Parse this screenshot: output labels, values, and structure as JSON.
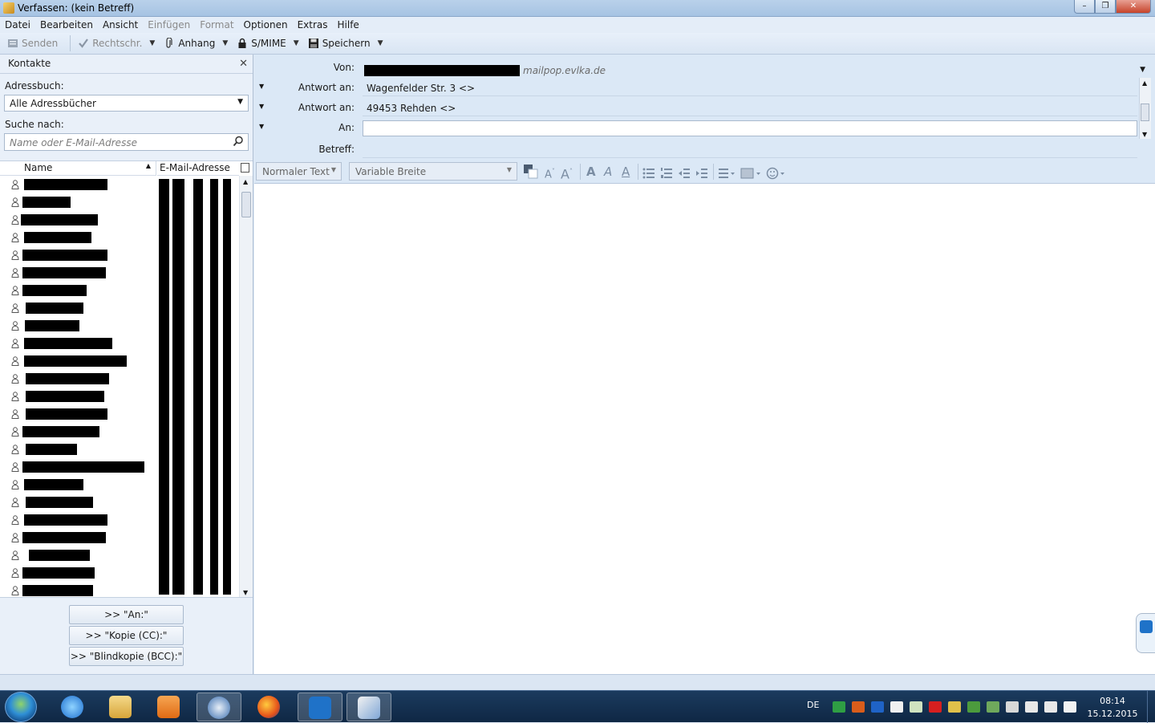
{
  "window": {
    "title": "Verfassen: (kein Betreff)",
    "controls": {
      "minimize": "–",
      "maximize": "❐",
      "close": "✕"
    }
  },
  "menu": [
    "Datei",
    "Bearbeiten",
    "Ansicht",
    "Einfügen",
    "Format",
    "Optionen",
    "Extras",
    "Hilfe"
  ],
  "menu_disabled": [
    "Einfügen",
    "Format"
  ],
  "toolbar": {
    "send": "Senden",
    "spell": "Rechtschr.",
    "attach": "Anhang",
    "smime": "S/MIME",
    "save": "Speichern"
  },
  "sidebar": {
    "title": "Kontakte",
    "address_book_label": "Adressbuch:",
    "address_book_value": "Alle Adressbücher",
    "search_label": "Suche nach:",
    "search_placeholder": "Name oder E-Mail-Adresse",
    "col_name": "Name",
    "col_email": "E-Mail-Adresse",
    "row_count": 24,
    "buttons": {
      "to": ">> \"An:\"",
      "cc": ">> \"Kopie (CC):\"",
      "bcc": ">> \"Blindkopie (BCC):\""
    }
  },
  "compose": {
    "from_label": "Von:",
    "from_domain": "mailpop.evlka.de",
    "reply1_label": "Antwort an:",
    "reply1_value": "Wagenfelder Str. 3 <>",
    "reply2_label": "Antwort an:",
    "reply2_value": "49453 Rehden <>",
    "to_label": "An:",
    "to_value": "",
    "subject_label": "Betreff:",
    "subject_value": ""
  },
  "format_bar": {
    "paragraph": "Normaler Text",
    "font": "Variable Breite"
  },
  "taskbar": {
    "lang": "DE",
    "time": "08:14",
    "date": "15.12.2015"
  },
  "colors": {
    "accent": "#1f72c8",
    "header_bg": "#dbe8f6",
    "taskbar_bg": "#1b3b5e"
  }
}
